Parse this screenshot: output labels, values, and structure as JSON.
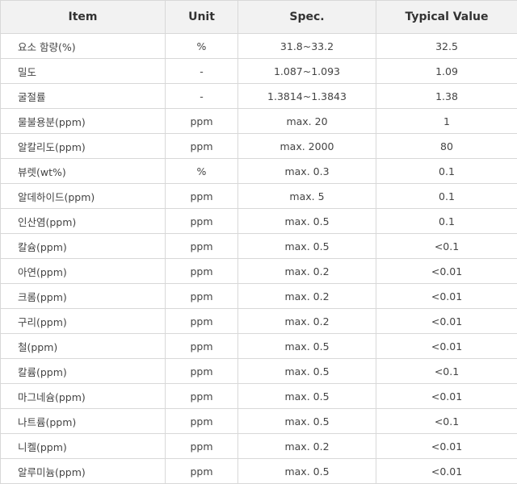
{
  "headers": [
    "Item",
    "Unit",
    "Spec.",
    "Typical Value"
  ],
  "rows": [
    {
      "item": "요소 함량(%)",
      "unit": "%",
      "spec": "31.8~33.2",
      "typical": "32.5"
    },
    {
      "item": "밀도",
      "unit": "-",
      "spec": "1.087~1.093",
      "typical": "1.09"
    },
    {
      "item": "굴절률",
      "unit": "-",
      "spec": "1.3814~1.3843",
      "typical": "1.38"
    },
    {
      "item": "물불용분(ppm)",
      "unit": "ppm",
      "spec": "max. 20",
      "typical": "1"
    },
    {
      "item": "알칼리도(ppm)",
      "unit": "ppm",
      "spec": "max. 2000",
      "typical": "80"
    },
    {
      "item": "뷰렛(wt%)",
      "unit": "%",
      "spec": "max. 0.3",
      "typical": "0.1"
    },
    {
      "item": "알데하이드(ppm)",
      "unit": "ppm",
      "spec": "max. 5",
      "typical": "0.1"
    },
    {
      "item": "인산염(ppm)",
      "unit": "ppm",
      "spec": "max. 0.5",
      "typical": "0.1"
    },
    {
      "item": "칼슘(ppm)",
      "unit": "ppm",
      "spec": "max. 0.5",
      "typical": "<0.1"
    },
    {
      "item": "아연(ppm)",
      "unit": "ppm",
      "spec": "max. 0.2",
      "typical": "<0.01"
    },
    {
      "item": "크롬(ppm)",
      "unit": "ppm",
      "spec": "max. 0.2",
      "typical": "<0.01"
    },
    {
      "item": "구리(ppm)",
      "unit": "ppm",
      "spec": "max. 0.2",
      "typical": "<0.01"
    },
    {
      "item": "철(ppm)",
      "unit": "ppm",
      "spec": "max. 0.5",
      "typical": "<0.01"
    },
    {
      "item": "칼륨(ppm)",
      "unit": "ppm",
      "spec": "max. 0.5",
      "typical": "<0.1"
    },
    {
      "item": "마그네슘(ppm)",
      "unit": "ppm",
      "spec": "max. 0.5",
      "typical": "<0.01"
    },
    {
      "item": "나트륨(ppm)",
      "unit": "ppm",
      "spec": "max. 0.5",
      "typical": "<0.1"
    },
    {
      "item": "니켈(ppm)",
      "unit": "ppm",
      "spec": "max. 0.2",
      "typical": "<0.01"
    },
    {
      "item": "알루미늄(ppm)",
      "unit": "ppm",
      "spec": "max. 0.5",
      "typical": "<0.01"
    }
  ]
}
